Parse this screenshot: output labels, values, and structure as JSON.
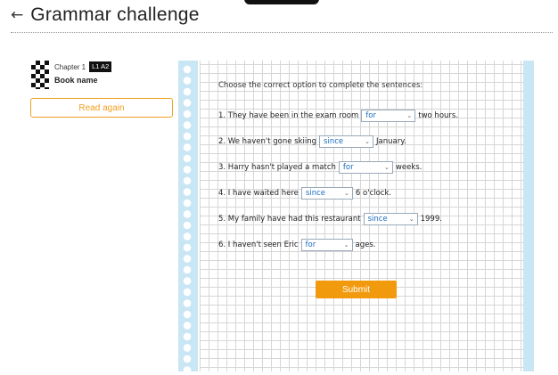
{
  "header": {
    "back_icon": "arrow-left-icon",
    "title": "Grammar challenge"
  },
  "book": {
    "chapter": "Chapter 1",
    "level": "L1 A2",
    "name": "Book name",
    "read_again_label": "Read again"
  },
  "exercise": {
    "instruction": "Choose the correct option to complete the sentences:",
    "sentences": [
      {
        "before": "1. They have been in the exam room",
        "answer": "for",
        "after": "two hours."
      },
      {
        "before": "2. We haven't gone skiing",
        "answer": "since",
        "after": "January."
      },
      {
        "before": "3. Harry hasn't played a match",
        "answer": "for",
        "after": "weeks."
      },
      {
        "before": "4. I have waited here",
        "answer": "since",
        "after": "6 o'clock."
      },
      {
        "before": "5. My family have had this restaurant",
        "answer": "since",
        "after": "1999."
      },
      {
        "before": "6. I haven't seen Eric",
        "answer": "for",
        "after": "ages."
      }
    ],
    "submit_label": "Submit"
  },
  "colors": {
    "accent": "#f29a0e",
    "dropdown_text": "#1b6bbf",
    "spiral": "#c9e6f4"
  }
}
